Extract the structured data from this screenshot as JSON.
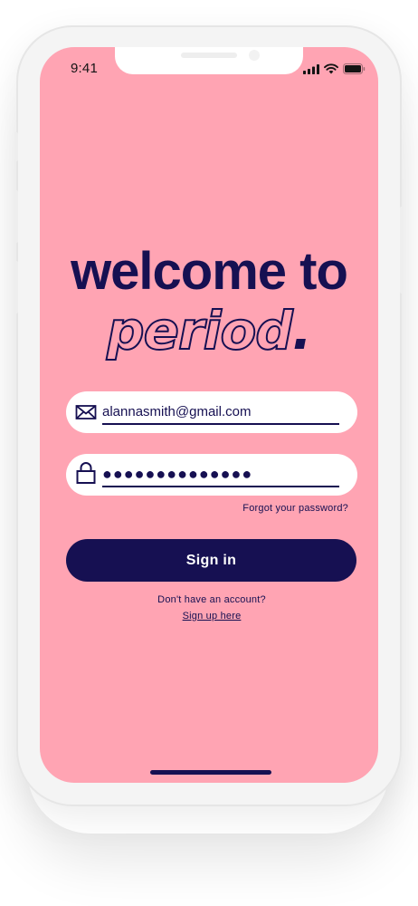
{
  "status_bar": {
    "time": "9:41",
    "icons": [
      "cellular-signal-icon",
      "wifi-icon",
      "battery-icon"
    ]
  },
  "login": {
    "headline": "welcome to",
    "brand_name": "period",
    "brand_dot": ".",
    "email_value": "alannasmith@gmail.com",
    "password_value": "●●●●●●●●●●●●●●",
    "email_icon": "envelope-icon",
    "password_icon": "lock-icon",
    "forgot_password_link": "Forgot your password?",
    "signin_button": "Sign in",
    "no_account_text": "Don't have an account?",
    "signup_link": "Sign up here"
  },
  "colors": {
    "background": "#ffa4b3",
    "primary": "#161052",
    "field_background": "#ffffff",
    "button_text": "#ffffff"
  }
}
